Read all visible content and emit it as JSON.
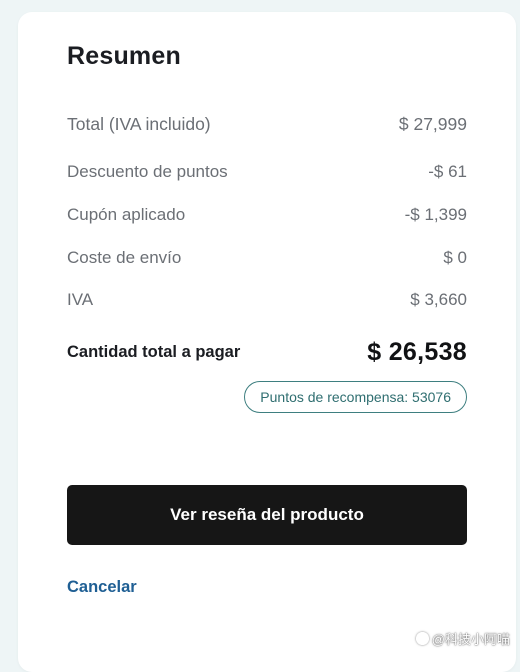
{
  "summary": {
    "title": "Resumen",
    "rows": [
      {
        "label": "Total (IVA incluido)",
        "value": "$ 27,999"
      },
      {
        "label": "Descuento de puntos",
        "value": "-$ 61"
      },
      {
        "label": "Cupón aplicado",
        "value": "-$ 1,399"
      },
      {
        "label": "Coste de envío",
        "value": "$ 0"
      },
      {
        "label": "IVA",
        "value": "$ 3,660"
      }
    ],
    "grand_total_label": "Cantidad total a pagar",
    "grand_total_value": "$ 26,538",
    "rewards_badge": "Puntos de recompensa: 53076"
  },
  "actions": {
    "review_button_label": "Ver reseña del producto",
    "cancel_label": "Cancelar"
  },
  "watermark": {
    "text": "@科技小阿喵",
    "icon": "circle-icon"
  },
  "colors": {
    "page_background": "#eef5f6",
    "card_background": "#ffffff",
    "button_background": "#161616",
    "link": "#1f5f94",
    "badge_border": "#3e7f80"
  }
}
